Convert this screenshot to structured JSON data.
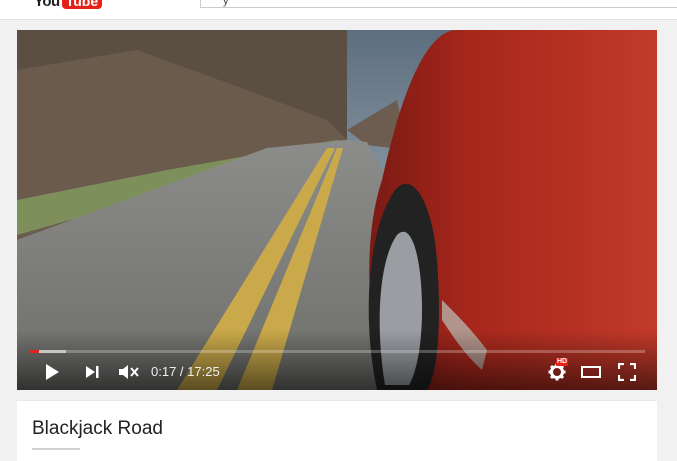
{
  "header": {
    "logo_you": "You",
    "logo_tube": "Tube",
    "search_value": "y"
  },
  "player": {
    "time_display": "0:17 / 17:25",
    "hd_badge": "HD",
    "progress_played": 0.016,
    "progress_loaded": 0.06
  },
  "video": {
    "title": "Blackjack Road"
  },
  "colors": {
    "brand_red": "#e62117"
  }
}
